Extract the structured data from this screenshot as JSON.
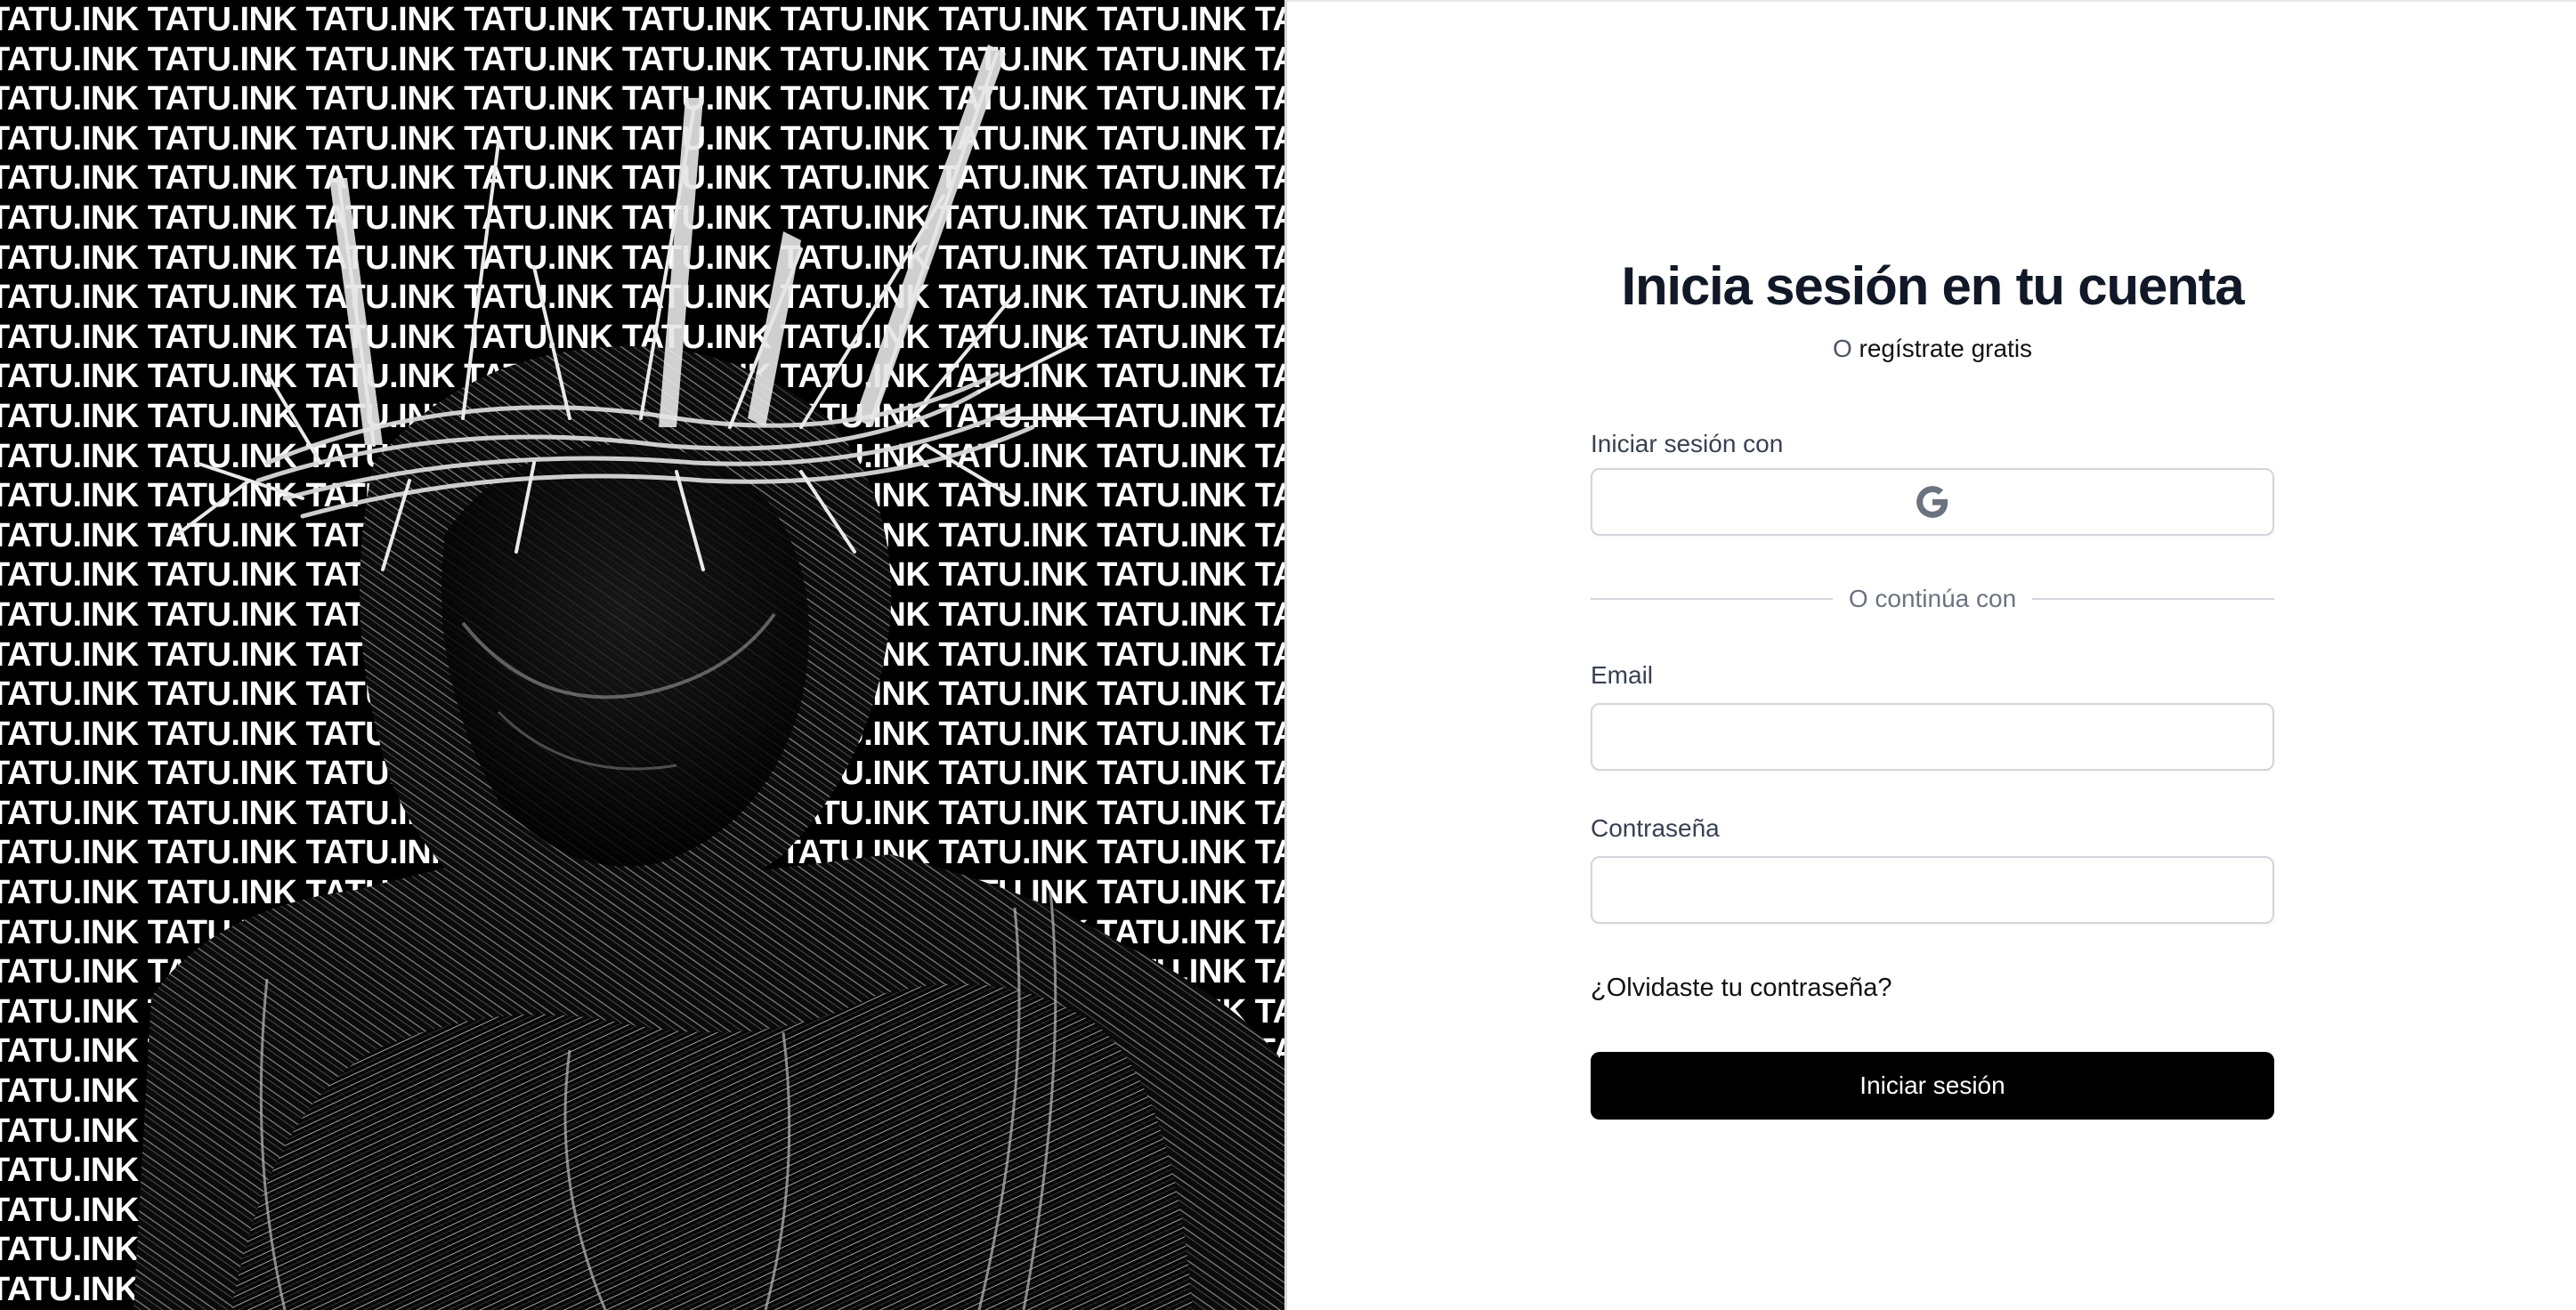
{
  "art": {
    "pattern_text": "TATU.INK",
    "pattern_color": "#ffffff",
    "background_color": "#000000"
  },
  "login": {
    "title": "Inicia sesión en tu cuenta",
    "subtitle_prefix": "O",
    "register_link": "regístrate gratis",
    "social_label": "Iniciar sesión con",
    "social_icon": "google-icon",
    "divider_text": "O continúa con",
    "email_label": "Email",
    "email_value": "",
    "password_label": "Contraseña",
    "password_value": "",
    "forgot_link": "¿Olvidaste tu contraseña?",
    "submit_label": "Iniciar sesión",
    "colors": {
      "title": "#111827",
      "button_bg": "#000000",
      "button_text": "#ffffff",
      "border": "#d1d5db",
      "muted": "#6b7280"
    }
  }
}
